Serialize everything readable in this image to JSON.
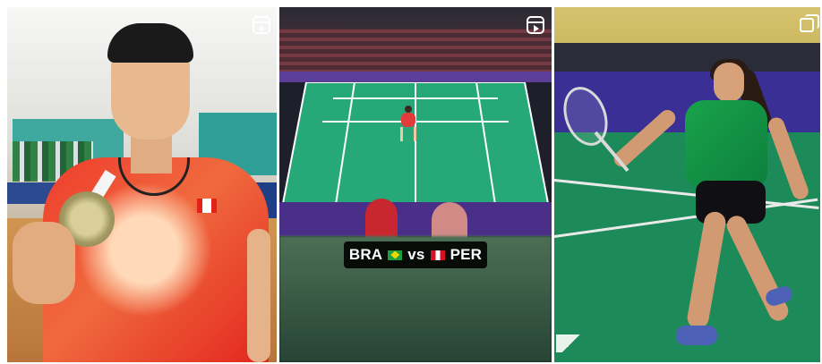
{
  "grid": {
    "tiles": [
      {
        "kind": "reel",
        "icon": "reel-icon"
      },
      {
        "kind": "reel",
        "icon": "reel-icon",
        "overlay": {
          "team_a": "BRA",
          "vs": "vs",
          "team_b": "PER"
        }
      },
      {
        "kind": "carousel",
        "icon": "carousel-icon"
      }
    ]
  },
  "colors": {
    "court_green": "#27a878",
    "board_purple": "#4a2f88",
    "caption_bg": "#000000",
    "caption_text": "#ffffff"
  }
}
